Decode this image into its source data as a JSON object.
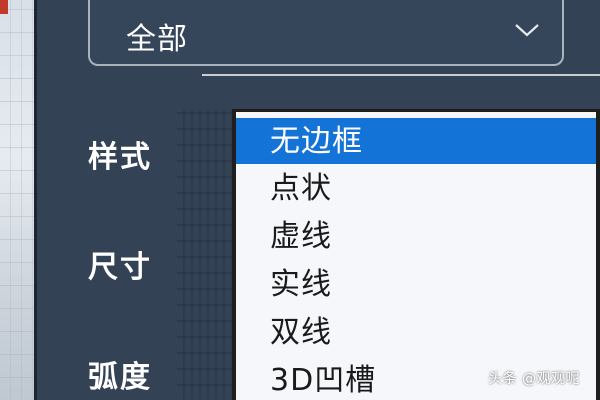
{
  "top_select": {
    "value": "全部",
    "icon": "chevron-down-icon"
  },
  "labels": {
    "style": "样式",
    "size": "尺寸",
    "radius": "弧度"
  },
  "dropdown": {
    "selected_index": 0,
    "options": [
      "无边框",
      "点状",
      "虚线",
      "实线",
      "双线",
      "3D凹槽"
    ]
  },
  "watermark": "头条 @观观呢"
}
